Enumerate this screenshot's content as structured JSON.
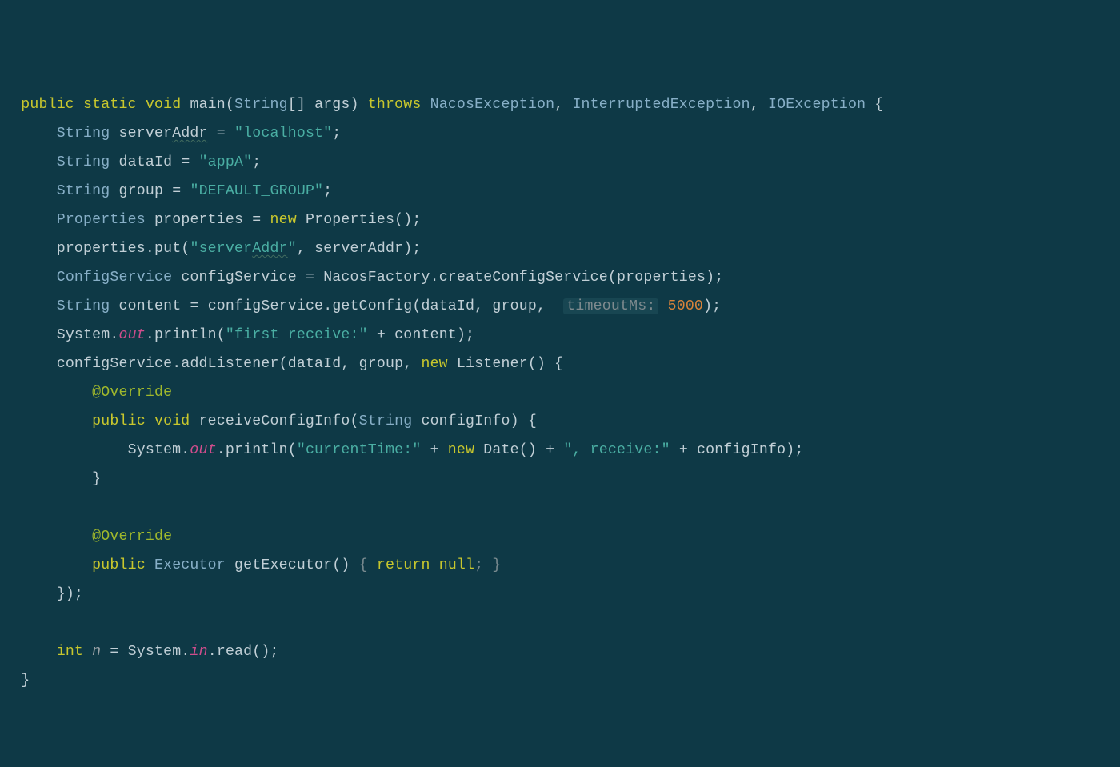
{
  "tok": {
    "public": "public",
    "static": "static",
    "void": "void",
    "throws": "throws",
    "new": "new",
    "return": "return",
    "null": "null",
    "int": "int",
    "main": "main",
    "String": "String",
    "args": "args",
    "NacosException": "NacosException",
    "InterruptedException": "InterruptedException",
    "IOException": "IOException",
    "serverAddr": "serverAddr",
    "underlineAddr": "Addr",
    "serverPrefix": "server",
    "str_localhost": "\"localhost\"",
    "dataId": "dataId",
    "str_appA": "\"appA\"",
    "group": "group",
    "str_default_group": "\"DEFAULT_GROUP\"",
    "Properties": "Properties",
    "properties": "properties",
    "put": "put",
    "str_serverAddr_pre": "\"server",
    "str_serverAddr_mid": "Addr",
    "str_serverAddr_suf": "\"",
    "ConfigService": "ConfigService",
    "configService": "configService",
    "NacosFactory": "NacosFactory",
    "createConfigService": "createConfigService",
    "content": "content",
    "getConfig": "getConfig",
    "hint_timeoutMs": "timeoutMs:",
    "num5000": "5000",
    "System": "System",
    "out": "out",
    "println": "println",
    "str_first_receive": "\"first receive:\"",
    "addListener": "addListener",
    "Listener": "Listener",
    "Override": "@Override",
    "receiveConfigInfo": "receiveConfigInfo",
    "configInfo": "configInfo",
    "str_currentTime": "\"currentTime:\"",
    "Date": "Date",
    "str_receive": "\", receive:\"",
    "Executor": "Executor",
    "getExecutor": "getExecutor",
    "n": "n",
    "in": "in",
    "read": "read"
  }
}
